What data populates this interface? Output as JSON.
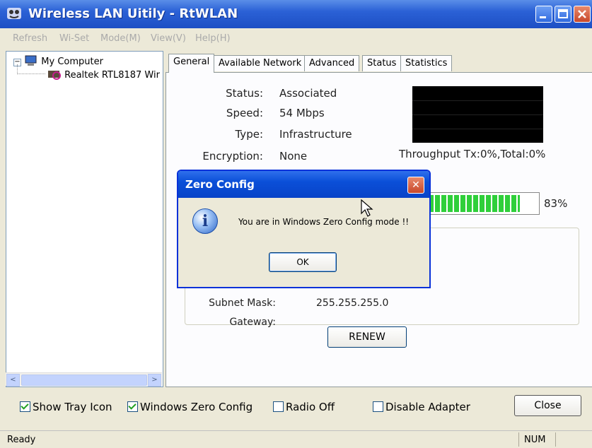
{
  "window": {
    "title": "Wireless LAN Uitily - RtWLAN"
  },
  "menu": [
    "Refresh",
    "Wi-Set",
    "Mode(M)",
    "View(V)",
    "Help(H)"
  ],
  "tree": {
    "root": "My Computer",
    "child": "Realtek RTL8187 Wir"
  },
  "tabs": [
    "General",
    "Available Network",
    "Advanced",
    "Status",
    "Statistics"
  ],
  "general": {
    "status_label": "Status:",
    "status_value": "Associated",
    "speed_label": "Speed:",
    "speed_value": "54 Mbps",
    "type_label": "Type:",
    "type_value": "Infrastructure",
    "encryption_label": "Encryption:",
    "encryption_value": "None",
    "throughput_text": "Throughput  Tx:0%,Total:0%",
    "signal_percent": 83,
    "signal_text": "83%",
    "subnet_label": "Subnet Mask:",
    "subnet_value": "255.255.255.0",
    "gateway_label": "Gateway:",
    "renew_label": "RENEW"
  },
  "options": {
    "show_tray_icon": {
      "label": "Show Tray Icon",
      "checked": true
    },
    "windows_zero_config": {
      "label": "Windows Zero Config",
      "checked": true
    },
    "radio_off": {
      "label": "Radio Off",
      "checked": false
    },
    "disable_adapter": {
      "label": "Disable Adapter",
      "checked": false
    },
    "close_label": "Close"
  },
  "statusbar": {
    "ready": "Ready",
    "num": "NUM"
  },
  "dialog": {
    "title": "Zero Config",
    "message": "You are in Windows Zero Config mode !!",
    "ok_label": "OK",
    "close_glyph": "✕"
  },
  "colors": {
    "titlebar": "#2b61d6",
    "signal": "#2fcf3a",
    "dialog_border": "#0831d9"
  }
}
